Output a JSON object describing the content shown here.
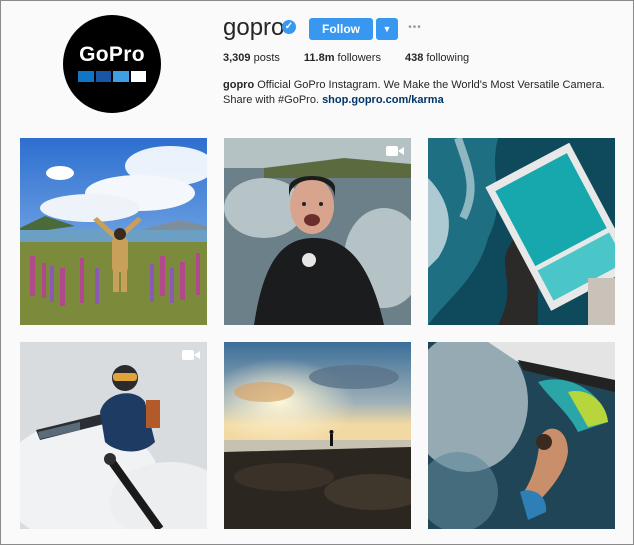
{
  "profile": {
    "username": "gopro",
    "verified_icon": "verified-badge-icon",
    "follow_label": "Follow",
    "dropdown_icon": "caret-down-icon",
    "more_icon": "ellipsis-icon",
    "more_glyph": "•••",
    "avatar_text": "GoPro",
    "avatar_colors": [
      "#0e75c7",
      "#1a56a6",
      "#3ea0e3",
      "#ffffff"
    ]
  },
  "stats": {
    "posts_value": "3,309",
    "posts_label": "posts",
    "followers_value": "11.8m",
    "followers_label": "followers",
    "following_value": "438",
    "following_label": "following"
  },
  "bio": {
    "name": "gopro",
    "text_line1": "Official GoPro Instagram. We Make the World's Most Versatile Camera.",
    "text_line2": "Share with #GoPro.",
    "link": "shop.gopro.com/karma"
  },
  "posts": [
    {
      "id": "post-lupines-mountains",
      "video": false
    },
    {
      "id": "post-surfer-selfie",
      "video": true
    },
    {
      "id": "post-ocean-pool-aerial",
      "video": false
    },
    {
      "id": "post-snowboarder-powder",
      "video": true
    },
    {
      "id": "post-sunset-coast",
      "video": false
    },
    {
      "id": "post-kitesurfer-underwater",
      "video": false
    }
  ],
  "colors": {
    "accent": "#3897f0",
    "link": "#003569",
    "text": "#262626"
  }
}
